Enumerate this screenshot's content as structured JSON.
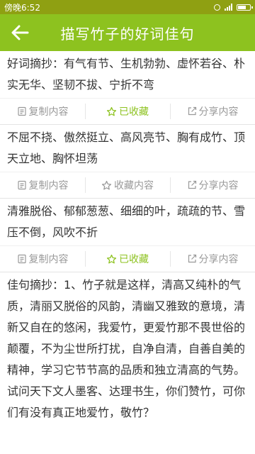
{
  "status_bar": {
    "carrier_time": "傍晚6:52"
  },
  "header": {
    "title": "描写竹子的好词佳句"
  },
  "colors": {
    "accent": "#8dc21f",
    "status_bar": "#8fa012",
    "muted": "#999999"
  },
  "cards": [
    {
      "text": "好词摘抄：有气有节、生机勃勃、虚怀若谷、朴实无华、坚韧不拔、宁折不弯",
      "copy_label": "复制内容",
      "fav_label": "已收藏",
      "fav_state": "favorited",
      "share_label": "分享内容"
    },
    {
      "text": "不屈不挠、傲然挺立、高风亮节、胸有成竹、顶天立地、胸怀坦荡",
      "copy_label": "复制内容",
      "fav_label": "收藏内容",
      "fav_state": "not-favorited",
      "share_label": "分享内容"
    },
    {
      "text": "清雅脱俗、郁郁葱葱、细细的叶，疏疏的节、雪压不倒，风吹不折",
      "copy_label": "复制内容",
      "fav_label": "已收藏",
      "fav_state": "favorited",
      "share_label": "分享内容"
    }
  ],
  "long_card": {
    "text": "佳句摘抄：1、竹子就是这样，清高又纯朴的气质，清丽又脱俗的风韵，清幽又雅致的意境，清新又自在的悠闲，我爱竹，更爱竹那不畏世俗的颠覆，不为尘世所打扰，自净自清，自善自美的精神，学习它节节高的品质和独立清高的气势。试问天下文人墨客、达理书生，你们赞竹，可你们有没有真正地爱竹，敬竹？"
  }
}
